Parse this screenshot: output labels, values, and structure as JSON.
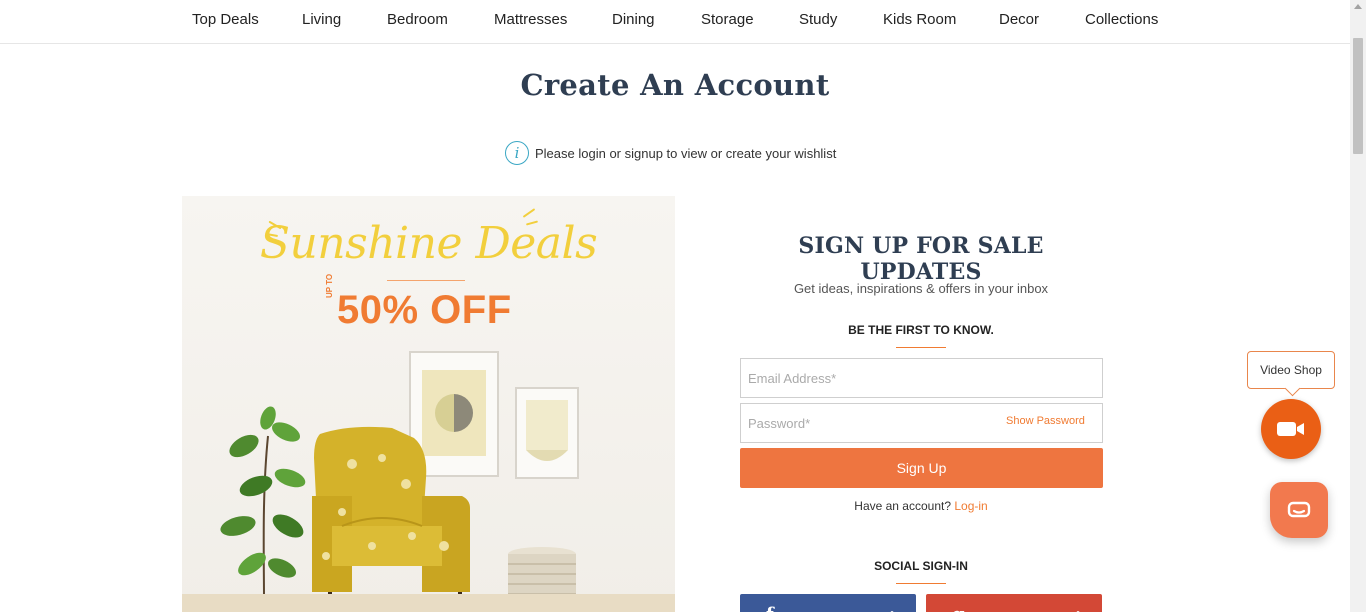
{
  "nav": {
    "items": [
      "Top Deals",
      "Living",
      "Bedroom",
      "Mattresses",
      "Dining",
      "Storage",
      "Study",
      "Kids Room",
      "Decor",
      "Collections"
    ]
  },
  "page": {
    "title": "Create An Account",
    "info_icon": "info-icon",
    "info_text": "Please login or signup to view or create your wishlist"
  },
  "promo": {
    "title": "Sunshine Deals",
    "upto": "UP TO",
    "discount": "50% OFF"
  },
  "signup": {
    "heading": "SIGN UP FOR SALE UPDATES",
    "subtext": "Get ideas, inspirations & offers in your inbox",
    "tagline": "BE THE FIRST TO KNOW.",
    "email_placeholder": "Email Address*",
    "password_placeholder": "Password*",
    "show_password": "Show Password",
    "button": "Sign Up",
    "have_account": "Have an account?",
    "login_link": "Log-in",
    "social_title": "SOCIAL SIGN-IN",
    "facebook_icon": "f",
    "google_icon": "g",
    "arrow": "›"
  },
  "widgets": {
    "video_shop": "Video Shop",
    "video_icon": "video-camera-icon",
    "chat_icon": "chat-bubble-icon"
  },
  "colors": {
    "accent": "#ee7540",
    "heading": "#2f3e52",
    "info": "#3aa7c4",
    "facebook": "#3b5998",
    "google": "#d34836"
  }
}
